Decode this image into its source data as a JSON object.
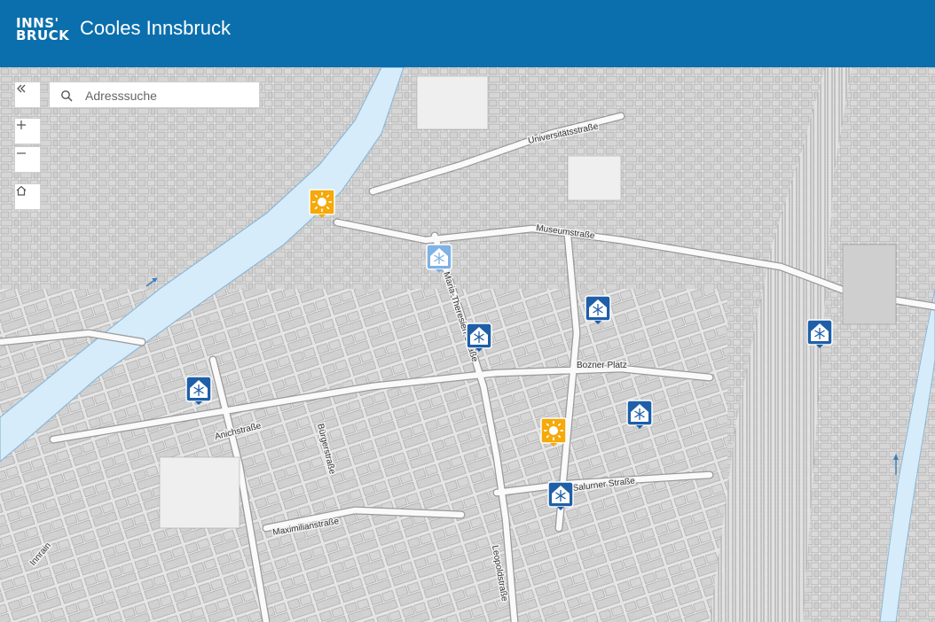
{
  "header": {
    "logo_line1": "INNS'",
    "logo_line2": "BRUCK",
    "title": "Cooles Innsbruck",
    "background_color": "#0b6fad"
  },
  "map_controls": {
    "collapse_icon": "double-chevron-left-icon",
    "zoom_in_icon": "plus-icon",
    "zoom_out_icon": "minus-icon",
    "home_icon": "home-icon"
  },
  "search": {
    "placeholder": "Adresssuche",
    "value": "",
    "icon": "search-icon"
  },
  "streets": [
    "Universitätsstraße",
    "Museumstraße",
    "Maria-Theresien-Straße",
    "Bozner Platz",
    "Anichstraße",
    "Bürgerstraße",
    "Salurner Straße",
    "Maximilianstraße",
    "Leopoldstraße",
    "Innrain"
  ],
  "marker_types": {
    "cool_place": {
      "icon": "snowflake-house-icon",
      "color": "#1e5fa8"
    },
    "cool_place_selected": {
      "icon": "snowflake-house-icon",
      "color": "#7fb2e5"
    },
    "sun_place": {
      "icon": "sun-icon",
      "color": "#f5a90a"
    }
  },
  "colors": {
    "river": "#d6ecfa",
    "river_edge": "#8fb8d6",
    "buildings": "#d0d0d0",
    "roads": "#fafafa"
  }
}
